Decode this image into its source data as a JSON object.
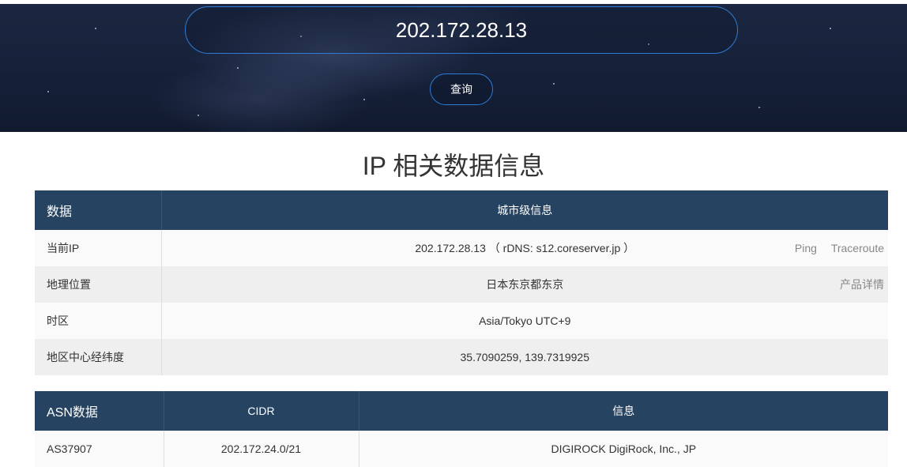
{
  "search": {
    "value": "202.172.28.13",
    "button_label": "查询"
  },
  "section_title": "IP 相关数据信息",
  "city_table": {
    "headers": [
      "数据",
      "城市级信息"
    ],
    "rows": [
      {
        "label": "当前IP",
        "value": "202.172.28.13 （ rDNS: s12.coreserver.jp ）",
        "links": [
          "Ping",
          "Traceroute"
        ]
      },
      {
        "label": "地理位置",
        "value": "日本东京都东京",
        "links": [
          "产品详情"
        ]
      },
      {
        "label": "时区",
        "value": "Asia/Tokyo UTC+9",
        "links": []
      },
      {
        "label": "地区中心经纬度",
        "value": "35.7090259, 139.7319925",
        "links": []
      }
    ]
  },
  "asn_table": {
    "headers": [
      "ASN数据",
      "CIDR",
      "信息"
    ],
    "rows": [
      {
        "asn": "AS37907",
        "cidr": "202.172.24.0/21",
        "info": "DIGIROCK DigiRock, Inc., JP"
      }
    ]
  },
  "colors": {
    "header_bg": "#264361",
    "accent_border": "#2f7bd6",
    "hero_bg": "#16213a"
  }
}
